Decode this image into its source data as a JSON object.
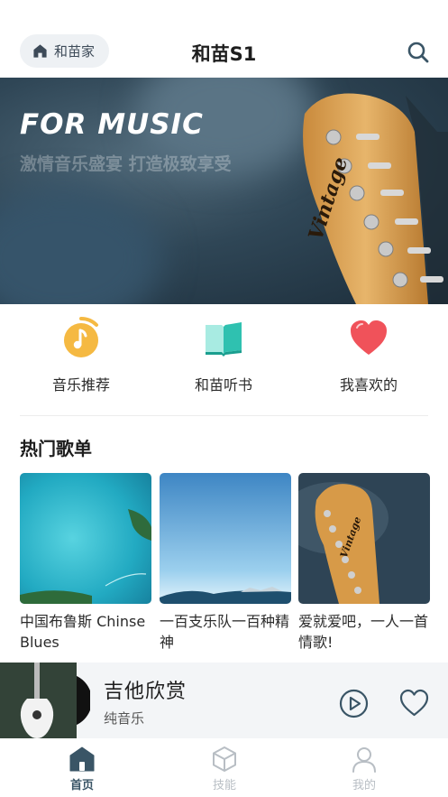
{
  "header": {
    "home_chip_label": "和苗家",
    "title": "和苗S1",
    "search_icon": "search-icon"
  },
  "banner": {
    "title": "FOR MUSIC",
    "subtitle": "激情音乐盛宴 打造极致享受"
  },
  "quick_actions": [
    {
      "label": "音乐推荐",
      "icon": "music-note-icon",
      "color": "#f5b942"
    },
    {
      "label": "和苗听书",
      "icon": "book-icon",
      "color": "#4fd1c0"
    },
    {
      "label": "我喜欢的",
      "icon": "heart-icon",
      "color": "#f0525a"
    }
  ],
  "hot_playlists": {
    "title": "热门歌单",
    "items": [
      {
        "title": "中国布鲁斯 Chinse Blues"
      },
      {
        "title": "一百支乐队一百种精神"
      },
      {
        "title": "爱就爱吧，一人一首情歌!"
      }
    ]
  },
  "player": {
    "song": "吉他欣赏",
    "genre": "纯音乐"
  },
  "tabbar": [
    {
      "label": "首页",
      "icon": "home-icon",
      "active": true
    },
    {
      "label": "技能",
      "icon": "cube-icon",
      "active": false
    },
    {
      "label": "我的",
      "icon": "user-icon",
      "active": false
    }
  ],
  "colors": {
    "accent": "#3a5566",
    "inactive": "#b8bec4"
  }
}
